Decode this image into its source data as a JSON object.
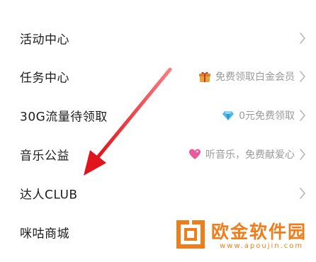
{
  "menu": {
    "items": [
      {
        "label": "活动中心",
        "hint": "",
        "hint_icon": ""
      },
      {
        "label": "任务中心",
        "hint": "免费领取白金会员",
        "hint_icon": "gift-icon"
      },
      {
        "label": "30G流量待领取",
        "hint": "0元免费领取",
        "hint_icon": "diamond-icon"
      },
      {
        "label": "音乐公益",
        "hint": "听音乐，免费献爱心",
        "hint_icon": "heart-icon"
      },
      {
        "label": "达人CLUB",
        "hint": "",
        "hint_icon": ""
      },
      {
        "label": "咪咕商城",
        "hint": "",
        "hint_icon": ""
      }
    ]
  },
  "watermark": {
    "title": "欧金软件园",
    "url": "www.apoujin.com"
  },
  "colors": {
    "text": "#1c1c1c",
    "hint": "#9a9a9a",
    "chevron": "#b5b5b5",
    "arrow": "#e0141c",
    "watermark": "#f07d1a"
  }
}
